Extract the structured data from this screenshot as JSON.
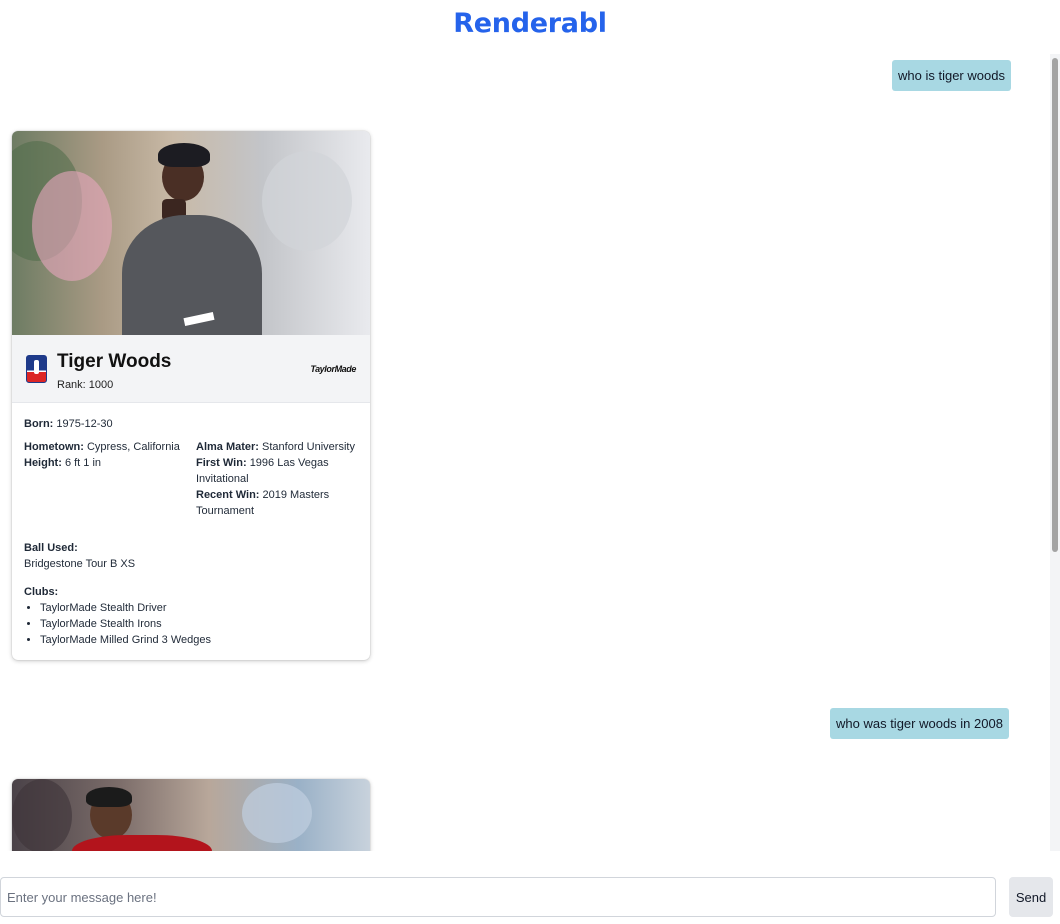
{
  "app": {
    "title": "Renderabl"
  },
  "messages": [
    {
      "role": "user",
      "text": "who is tiger woods"
    },
    {
      "role": "assistant",
      "card": {
        "photo_alt": "Tiger Woods photo",
        "name": "Tiger Woods",
        "rank_label": "Rank: 1000",
        "sponsor": "TaylorMade",
        "born_label": "Born:",
        "born": "1975-12-30",
        "hometown_label": "Hometown:",
        "hometown": "Cypress, California",
        "height_label": "Height:",
        "height": "6 ft 1 in",
        "alma_mater_label": "Alma Mater:",
        "alma_mater": "Stanford University",
        "first_win_label": "First Win:",
        "first_win": "1996 Las Vegas Invitational",
        "recent_win_label": "Recent Win:",
        "recent_win": "2019 Masters Tournament",
        "ball_label": "Ball Used:",
        "ball": "Bridgestone Tour B XS",
        "clubs_label": "Clubs:",
        "clubs": [
          "TaylorMade Stealth Driver",
          "TaylorMade Stealth Irons",
          "TaylorMade Milled Grind 3 Wedges"
        ]
      }
    },
    {
      "role": "user",
      "text": "who was tiger woods in 2008"
    }
  ],
  "composer": {
    "placeholder": "Enter your message here!",
    "value": "",
    "send_label": "Send"
  }
}
